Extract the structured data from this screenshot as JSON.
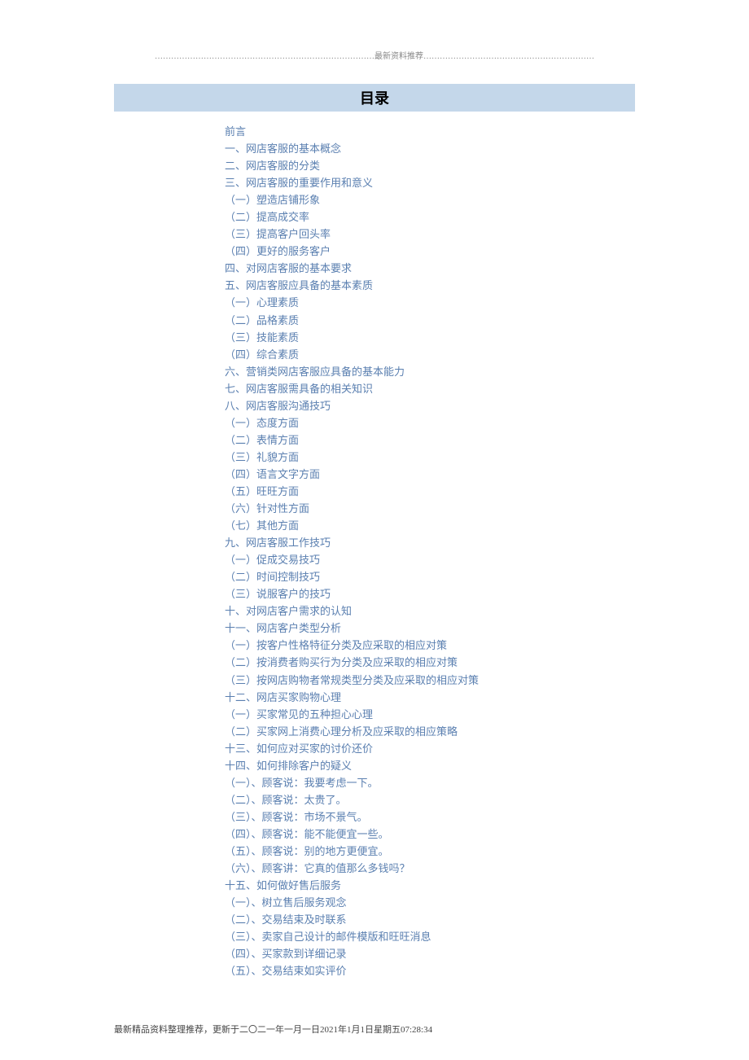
{
  "header_rule": "………………………………………………………………………最新资料推荐………………………………………………………",
  "toc_title": "目录",
  "toc": [
    {
      "label": "前言",
      "level": 1
    },
    {
      "label": "一、网店客服的基本概念",
      "level": 1
    },
    {
      "label": "二、网店客服的分类",
      "level": 1
    },
    {
      "label": "三、网店客服的重要作用和意义",
      "level": 1
    },
    {
      "label": "（一）塑造店铺形象",
      "level": 2
    },
    {
      "label": "（二）提高成交率",
      "level": 2
    },
    {
      "label": "（三）提高客户回头率",
      "level": 2
    },
    {
      "label": "（四）更好的服务客户",
      "level": 2
    },
    {
      "label": "四、对网店客服的基本要求",
      "level": 1
    },
    {
      "label": "五、网店客服应具备的基本素质",
      "level": 1
    },
    {
      "label": "（一）心理素质",
      "level": 2
    },
    {
      "label": "（二）品格素质",
      "level": 2
    },
    {
      "label": "（三）技能素质",
      "level": 2
    },
    {
      "label": "（四）综合素质",
      "level": 2
    },
    {
      "label": "六、营销类网店客服应具备的基本能力",
      "level": 1
    },
    {
      "label": "七、网店客服需具备的相关知识",
      "level": 1
    },
    {
      "label": "八、网店客服沟通技巧",
      "level": 1
    },
    {
      "label": "（一）态度方面",
      "level": 2
    },
    {
      "label": "（二）表情方面",
      "level": 2
    },
    {
      "label": "（三）礼貌方面",
      "level": 2
    },
    {
      "label": "（四）语言文字方面",
      "level": 2
    },
    {
      "label": "（五）旺旺方面",
      "level": 2
    },
    {
      "label": "（六）针对性方面",
      "level": 2
    },
    {
      "label": "（七）其他方面",
      "level": 2
    },
    {
      "label": "九、网店客服工作技巧",
      "level": 1
    },
    {
      "label": "（一）促成交易技巧",
      "level": 2
    },
    {
      "label": "（二）时间控制技巧",
      "level": 2
    },
    {
      "label": "（三）说服客户的技巧",
      "level": 2
    },
    {
      "label": "十、对网店客户需求的认知",
      "level": 1
    },
    {
      "label": "十一、网店客户类型分析",
      "level": 1
    },
    {
      "label": "（一）按客户性格特征分类及应采取的相应对策",
      "level": 2
    },
    {
      "label": "（二）按消费者购买行为分类及应采取的相应对策",
      "level": 2
    },
    {
      "label": "（三）按网店购物者常规类型分类及应采取的相应对策",
      "level": 2
    },
    {
      "label": "十二、网店买家购物心理",
      "level": 1
    },
    {
      "label": "（一）买家常见的五种担心心理",
      "level": 2
    },
    {
      "label": "（二）买家网上消费心理分析及应采取的相应策略",
      "level": 2
    },
    {
      "label": "十三、如何应对买家的讨价还价",
      "level": 1
    },
    {
      "label": "十四、如何排除客户的疑义",
      "level": 1
    },
    {
      "label": "（一）、顾客说：我要考虑一下。",
      "level": 2
    },
    {
      "label": "（二）、顾客说：太贵了。",
      "level": 2
    },
    {
      "label": "（三）、顾客说：市场不景气。",
      "level": 2
    },
    {
      "label": "（四）、顾客说：能不能便宜一些。",
      "level": 2
    },
    {
      "label": "（五）、顾客说：别的地方更便宜。",
      "level": 2
    },
    {
      "label": "（六）、顾客讲：它真的值那么多钱吗？",
      "level": 2
    },
    {
      "label": "十五、如何做好售后服务",
      "level": 1
    },
    {
      "label": "（一）、树立售后服务观念",
      "level": 2
    },
    {
      "label": "（二）、交易结束及时联系",
      "level": 2
    },
    {
      "label": "（三）、卖家自己设计的邮件模版和旺旺消息",
      "level": 2
    },
    {
      "label": "（四）、买家款到详细记录",
      "level": 2
    },
    {
      "label": "（五）、交易结束如实评价",
      "level": 2
    }
  ],
  "footer": "最新精品资料整理推荐，更新于二〇二一年一月一日2021年1月1日星期五07:28:34"
}
